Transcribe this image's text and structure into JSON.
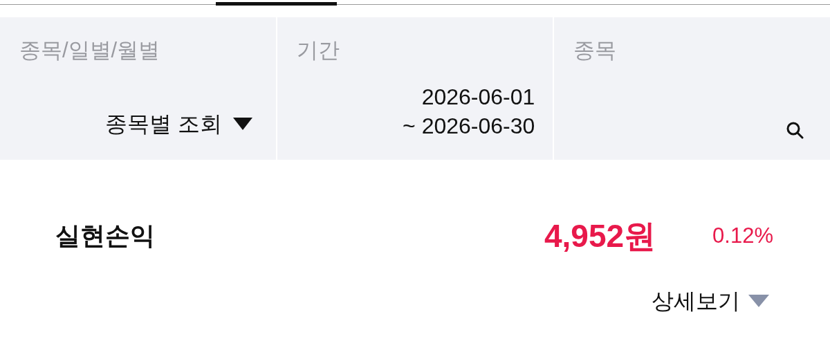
{
  "filters": [
    {
      "kind": "dropdown",
      "label": "종목/일별/월별",
      "value": "종목별 조회"
    },
    {
      "kind": "period",
      "label": "기간",
      "start": "2026-06-01",
      "end": "~ 2026-06-30"
    },
    {
      "kind": "search",
      "label": "종목"
    }
  ],
  "summary": {
    "label": "실현손익",
    "amount": "4,952원",
    "rate": "0.12%"
  },
  "details": {
    "label": "상세보기",
    "expanded": false
  }
}
